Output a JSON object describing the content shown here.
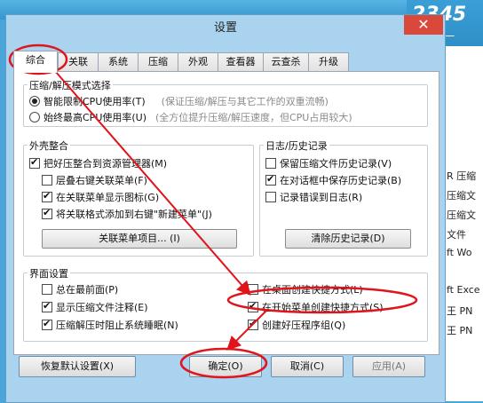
{
  "background": {
    "brand": "2345好",
    "brand_sub": "第一",
    "side_items": [
      "R 压缩",
      "压缩文",
      "压缩文",
      "文件",
      "ft Wo",
      "ft Exce",
      "王 PN",
      "王 PN"
    ]
  },
  "dialog": {
    "title": "设置",
    "close_glyph": "✕",
    "tabs": [
      {
        "label": "综合",
        "active": true
      },
      {
        "label": "关联"
      },
      {
        "label": "系统"
      },
      {
        "label": "压缩"
      },
      {
        "label": "外观"
      },
      {
        "label": "查看器"
      },
      {
        "label": "云查杀"
      },
      {
        "label": "升级"
      }
    ],
    "compress_mode": {
      "title": "压缩/解压模式选择",
      "options": [
        {
          "label": "智能限制CPU使用率(T)",
          "hint": "(保证压缩/解压与其它工作的双重流畅)",
          "selected": true
        },
        {
          "label": "始终最高CPU使用率(U)",
          "hint": "(全方位提升压缩/解压速度，但CPU占用较大)",
          "selected": false
        }
      ]
    },
    "shell": {
      "title": "外壳整合",
      "items": [
        {
          "label": "把好压整合到资源管理器(M)",
          "checked": true
        },
        {
          "label": "层叠右键关联菜单(F)",
          "checked": false
        },
        {
          "label": "在关联菜单显示图标(G)",
          "checked": true
        },
        {
          "label": "将关联格式添加到右键\"新建菜单\"(J)",
          "checked": true
        }
      ],
      "button": "关联菜单项目... (I)"
    },
    "log": {
      "title": "日志/历史记录",
      "items": [
        {
          "label": "保留压缩文件历史记录(V)",
          "checked": false
        },
        {
          "label": "在对话框中保存历史记录(B)",
          "checked": true
        },
        {
          "label": "记录错误到日志(R)",
          "checked": false
        }
      ],
      "button": "清除历史记录(D)"
    },
    "ui": {
      "title": "界面设置",
      "left": [
        {
          "label": "总在最前面(P)",
          "checked": false
        },
        {
          "label": "显示压缩文件注释(E)",
          "checked": true
        },
        {
          "label": "压缩解压时阻止系统睡眠(N)",
          "checked": true
        }
      ],
      "right": [
        {
          "label": "在桌面创建快捷方式(L)",
          "checked": false
        },
        {
          "label": "在开始菜单创建快捷方式(S)",
          "checked": true
        },
        {
          "label": "创建好压程序组(Q)",
          "checked": true
        }
      ]
    },
    "footer": {
      "reset": "恢复默认设置(X)",
      "ok": "确定(O)",
      "cancel": "取消(C)",
      "apply": "应用(A)"
    }
  },
  "colors": {
    "annotation": "#e0151b",
    "dialog_bg": "#a9d3ef"
  }
}
